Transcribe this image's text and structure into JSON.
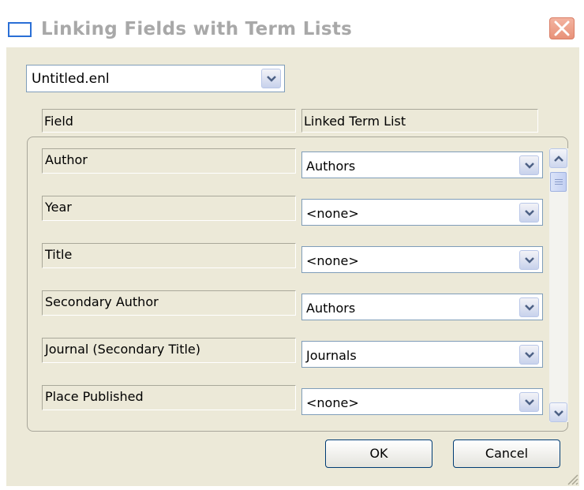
{
  "window": {
    "title": "Linking Fields with Term Lists"
  },
  "library_select": {
    "value": "Untitled.enl"
  },
  "columns": {
    "field": "Field",
    "linked": "Linked Term List"
  },
  "rows": [
    {
      "field": "Author",
      "list": "Authors"
    },
    {
      "field": "Year",
      "list": "<none>"
    },
    {
      "field": "Title",
      "list": "<none>"
    },
    {
      "field": "Secondary Author",
      "list": "Authors"
    },
    {
      "field": "Journal (Secondary Title)",
      "list": "Journals"
    },
    {
      "field": "Place Published",
      "list": "<none>"
    }
  ],
  "buttons": {
    "ok": "OK",
    "cancel": "Cancel"
  },
  "icons": {
    "window": "window-icon",
    "close": "close-x-icon",
    "dropdown": "chevron-down-icon",
    "scroll_up": "arrow-up-icon",
    "scroll_down": "arrow-down-icon"
  },
  "colors": {
    "close_button": "#e89279",
    "client": "#ece9d8",
    "title_text": "#a8a8a8"
  }
}
